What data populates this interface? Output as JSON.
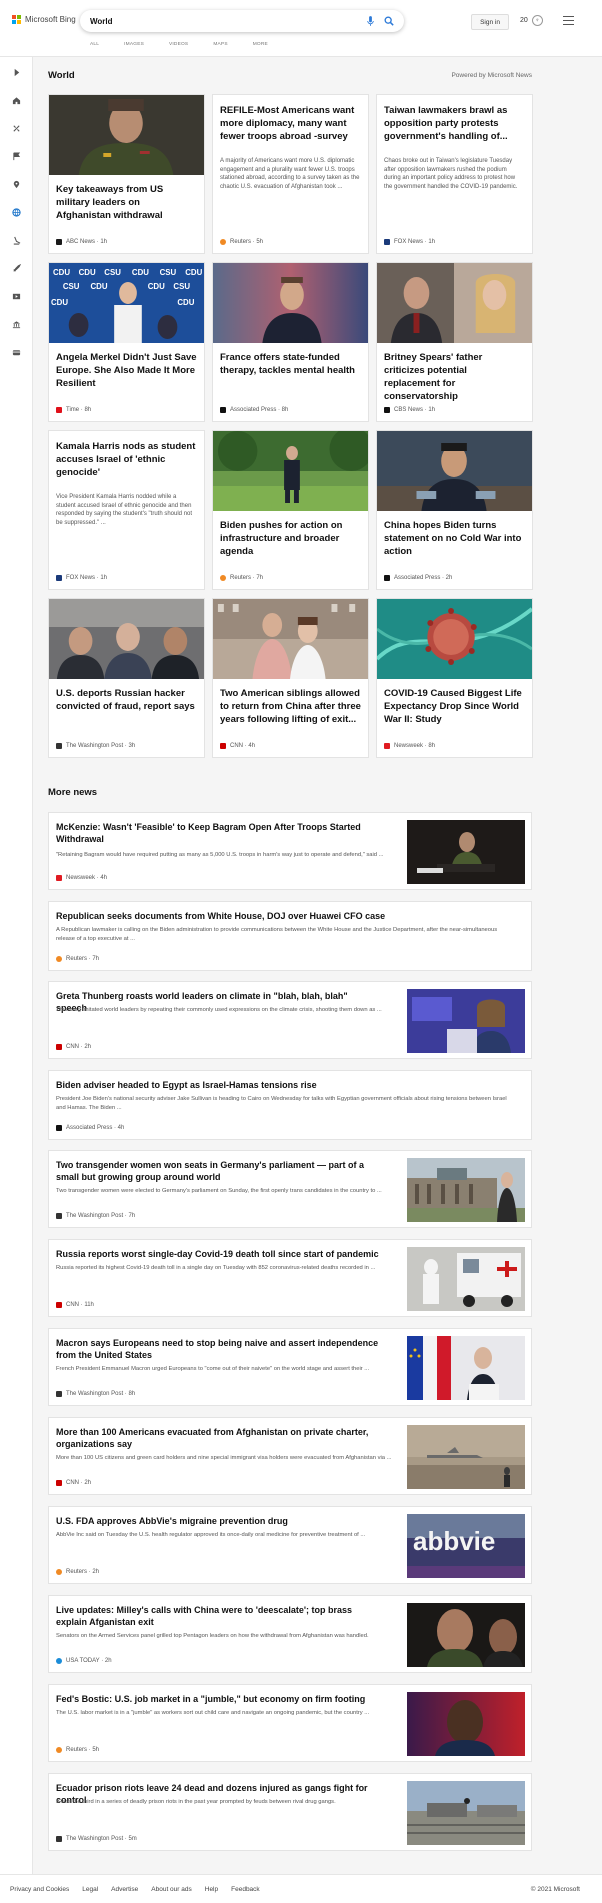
{
  "header": {
    "logo_text": "Microsoft Bing",
    "search_value": "World",
    "signin_label": "Sign in",
    "reward_count": "20",
    "tabs": [
      "ALL",
      "IMAGES",
      "VIDEOS",
      "MAPS",
      "MORE"
    ]
  },
  "sidebar": {
    "icons": [
      "chevron-right-icon",
      "home-icon",
      "sparkle-icon",
      "flag-icon",
      "location-icon",
      "globe-icon",
      "science-icon",
      "rocket-icon",
      "entertainment-icon",
      "money-icon",
      "card-icon"
    ]
  },
  "section": {
    "title": "World",
    "powered": "Powered by Microsoft News"
  },
  "cards": [
    {
      "title": "Key takeaways from US military leaders on Afghanistan withdrawal",
      "snippet": "",
      "source": "ABC News · 1h",
      "src_color": "#1a1a1a",
      "image": "military"
    },
    {
      "title": "REFILE-Most Americans want more diplomacy, many want fewer troops abroad -survey",
      "snippet": "A majority of Americans want more U.S. diplomatic engagement and a plurality want fewer U.S. troops stationed abroad, according to a survey taken as the chaotic U.S. evacuation of Afghanistan took ...",
      "source": "Reuters · 5h",
      "src_color": "#f08a24",
      "image": ""
    },
    {
      "title": "Taiwan lawmakers brawl as opposition party protests government's handling of...",
      "snippet": "Chaos broke out in Taiwan's legislature Tuesday after opposition lawmakers rushed the podium during an important policy address to protest how the government handled the COVID-19 pandemic.",
      "source": "FOX News · 1h",
      "src_color": "#1b3a7a",
      "image": ""
    },
    {
      "title": "Angela Merkel Didn't Just Save Europe. She Also Made It More Resilient",
      "snippet": "",
      "source": "Time · 8h",
      "src_color": "#e0101a",
      "image": "cdu"
    },
    {
      "title": "France offers state-funded therapy, tackles mental health",
      "snippet": "",
      "source": "Associated Press · 8h",
      "src_color": "#111111",
      "image": "macron"
    },
    {
      "title": "Britney Spears' father criticizes potential replacement for conservatorship",
      "snippet": "",
      "source": "CBS News · 1h",
      "src_color": "#111111",
      "image": "spears"
    },
    {
      "title": "Kamala Harris nods as student accuses Israel of 'ethnic genocide'",
      "snippet": "Vice President Kamala Harris nodded while a student accused Israel of ethnic genocide and then responded by saying the student's \"truth should not be suppressed.\" ...",
      "source": "FOX News · 1h",
      "src_color": "#1b3a7a",
      "image": ""
    },
    {
      "title": "Biden pushes for action on infrastructure and broader agenda",
      "snippet": "",
      "source": "Reuters · 7h",
      "src_color": "#f08a24",
      "image": "lawn"
    },
    {
      "title": "China hopes Biden turns statement on no Cold War into action",
      "snippet": "",
      "source": "Associated Press · 2h",
      "src_color": "#111111",
      "image": "un"
    },
    {
      "title": "U.S. deports Russian hacker convicted of fraud, report says",
      "snippet": "",
      "source": "The Washington Post · 3h",
      "src_color": "#333333",
      "image": "hacker"
    },
    {
      "title": "Two American siblings allowed to return from China after three years following lifting of exit...",
      "snippet": "",
      "source": "CNN · 4h",
      "src_color": "#cc0000",
      "image": "siblings"
    },
    {
      "title": "COVID-19 Caused Biggest Life Expectancy Drop Since World War II: Study",
      "snippet": "",
      "source": "Newsweek · 8h",
      "src_color": "#e01b22",
      "image": "virus"
    }
  ],
  "more": {
    "title": "More news",
    "items": [
      {
        "title": "McKenzie: Wasn't 'Feasible' to Keep Bagram Open After Troops Started Withdrawal",
        "snippet": "\"Retaining Bagram would have required putting as many as 5,000 U.S. troops in harm's way just to operate and defend,\" said ...",
        "source": "Newsweek · 4h",
        "src_color": "#e01b22",
        "thumb": "hearing"
      },
      {
        "title": "Republican seeks documents from White House, DOJ over Huawei CFO case",
        "snippet": "A Republican lawmaker is calling on the Biden administration to provide communications between the White House and the Justice Department, after the near-simultaneous release of a top executive at ...",
        "source": "Reuters · 7h",
        "src_color": "#f08a24",
        "thumb": ""
      },
      {
        "title": "Greta Thunberg roasts world leaders on climate in \"blah, blah, blah\" speech",
        "snippet": "Thunberg imitated world leaders by repeating their commonly used expressions on the climate crisis, shooting them down as ...",
        "source": "CNN · 2h",
        "src_color": "#cc0000",
        "thumb": "greta"
      },
      {
        "title": "Biden adviser headed to Egypt as Israel-Hamas tensions rise",
        "snippet": "President Joe Biden's national security adviser Jake Sullivan is heading to Cairo on Wednesday for talks with Egyptian government officials about rising tensions between Israel and Hamas. The Biden ...",
        "source": "Associated Press · 4h",
        "src_color": "#111111",
        "thumb": ""
      },
      {
        "title": "Two transgender women won seats in Germany's parliament — part of a small but growing group around world",
        "snippet": "Two transgender women were elected to Germany's parliament on Sunday, the first openly trans candidates in the country to ...",
        "source": "The Washington Post · 7h",
        "src_color": "#333333",
        "thumb": "reichstag"
      },
      {
        "title": "Russia reports worst single-day Covid-19 death toll since start of pandemic",
        "snippet": "Russia reported its highest Covid-19 death toll in a single day on Tuesday with 852 coronavirus-related deaths recorded in ...",
        "source": "CNN · 11h",
        "src_color": "#cc0000",
        "thumb": "ambulance"
      },
      {
        "title": "Macron says Europeans need to stop being naive and assert independence from the United States",
        "snippet": "French President Emmanuel Macron urged Europeans to \"come out of their naivete\" on the world stage and assert their ...",
        "source": "The Washington Post · 8h",
        "src_color": "#333333",
        "thumb": "podium"
      },
      {
        "title": "More than 100 Americans evacuated from Afghanistan on private charter, organizations say",
        "snippet": "More than 100 US citizens and green card holders and nine special immigrant visa holders were evacuated from Afghanistan via ...",
        "source": "CNN · 2h",
        "src_color": "#cc0000",
        "thumb": "airfield"
      },
      {
        "title": "U.S. FDA approves AbbVie's migraine prevention drug",
        "snippet": "AbbVie Inc said on Tuesday the U.S. health regulator approved its once-daily oral medicine for preventive treatment of ...",
        "source": "Reuters · 2h",
        "src_color": "#f08a24",
        "thumb": "abbvie"
      },
      {
        "title": "Live updates: Milley's calls with China were to 'deescalate'; top brass explain Afganistan exit",
        "snippet": "Senators on the Armed Services panel grilled top Pentagon leaders on how the withdrawal from Afghanistan was handled.",
        "source": "USA TODAY · 2h",
        "src_color": "#1a8cd8",
        "thumb": "milley"
      },
      {
        "title": "Fed's Bostic: U.S. job market in a \"jumble,\" but economy on firm footing",
        "snippet": "The U.S. labor market is in a \"jumble\" as workers sort out child care and navigate an ongoing pandemic, but the country ...",
        "source": "Reuters · 5h",
        "src_color": "#f08a24",
        "thumb": "bostic"
      },
      {
        "title": "Ecuador prison riots leave 24 dead and dozens injured as gangs fight for control",
        "snippet": "It was the third in a series of deadly prison riots in the past year prompted by feuds between rival drug gangs.",
        "source": "The Washington Post · 5m",
        "src_color": "#333333",
        "thumb": "prison"
      }
    ]
  },
  "footer": {
    "links": [
      "Privacy and Cookies",
      "Legal",
      "Advertise",
      "About our ads",
      "Help",
      "Feedback"
    ],
    "copyright": "© 2021 Microsoft"
  }
}
